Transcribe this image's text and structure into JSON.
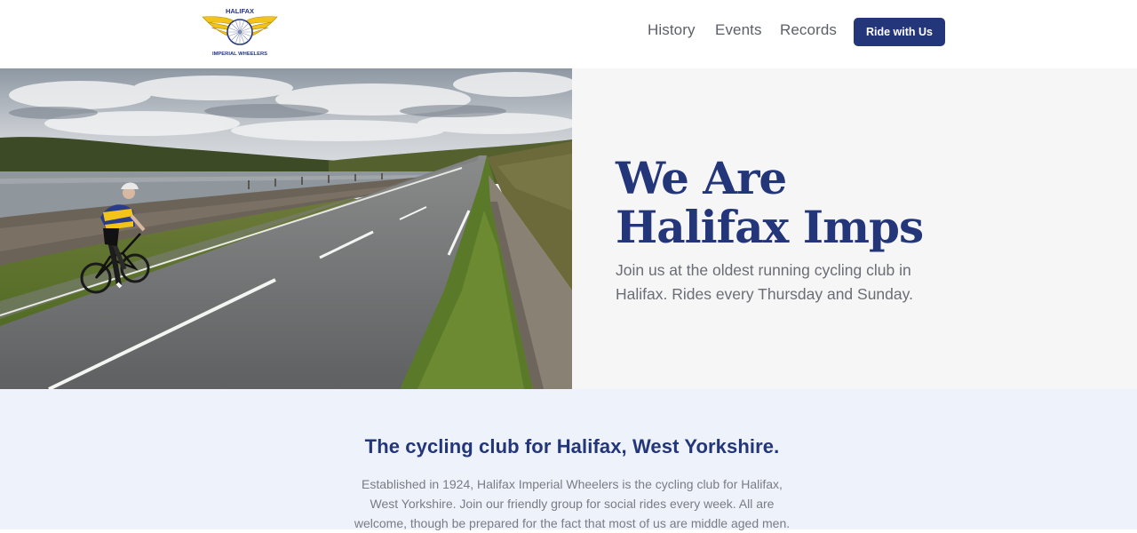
{
  "header": {
    "logo": {
      "icon": "winged-wheel-logo",
      "text_top": "HALIFAX",
      "text_bottom": "IMPERIAL WHEELERS",
      "wing_color": "#f2c319",
      "text_color": "#24367a"
    },
    "nav": [
      {
        "label": "History"
      },
      {
        "label": "Events"
      },
      {
        "label": "Records"
      }
    ],
    "cta_label": "Ride with Us"
  },
  "hero": {
    "image_icon": "cyclist-road-photo",
    "title_line1": "We Are",
    "title_line2": "Halifax Imps",
    "subtitle": "Join us at the oldest running cycling club in Halifax. Rides every Thursday and Sunday."
  },
  "about": {
    "heading": "The cycling club for Halifax, West Yorkshire.",
    "body": "Established in 1924, Halifax Imperial Wheelers is the cycling club for Halifax, West Yorkshire. Join our friendly group for social rides every week. All are welcome, though be prepared for the fact that most of us are middle aged men."
  },
  "colors": {
    "brand": "#24367a",
    "hero_bg": "#f6f6f7",
    "section_bg": "#eef2fb"
  }
}
